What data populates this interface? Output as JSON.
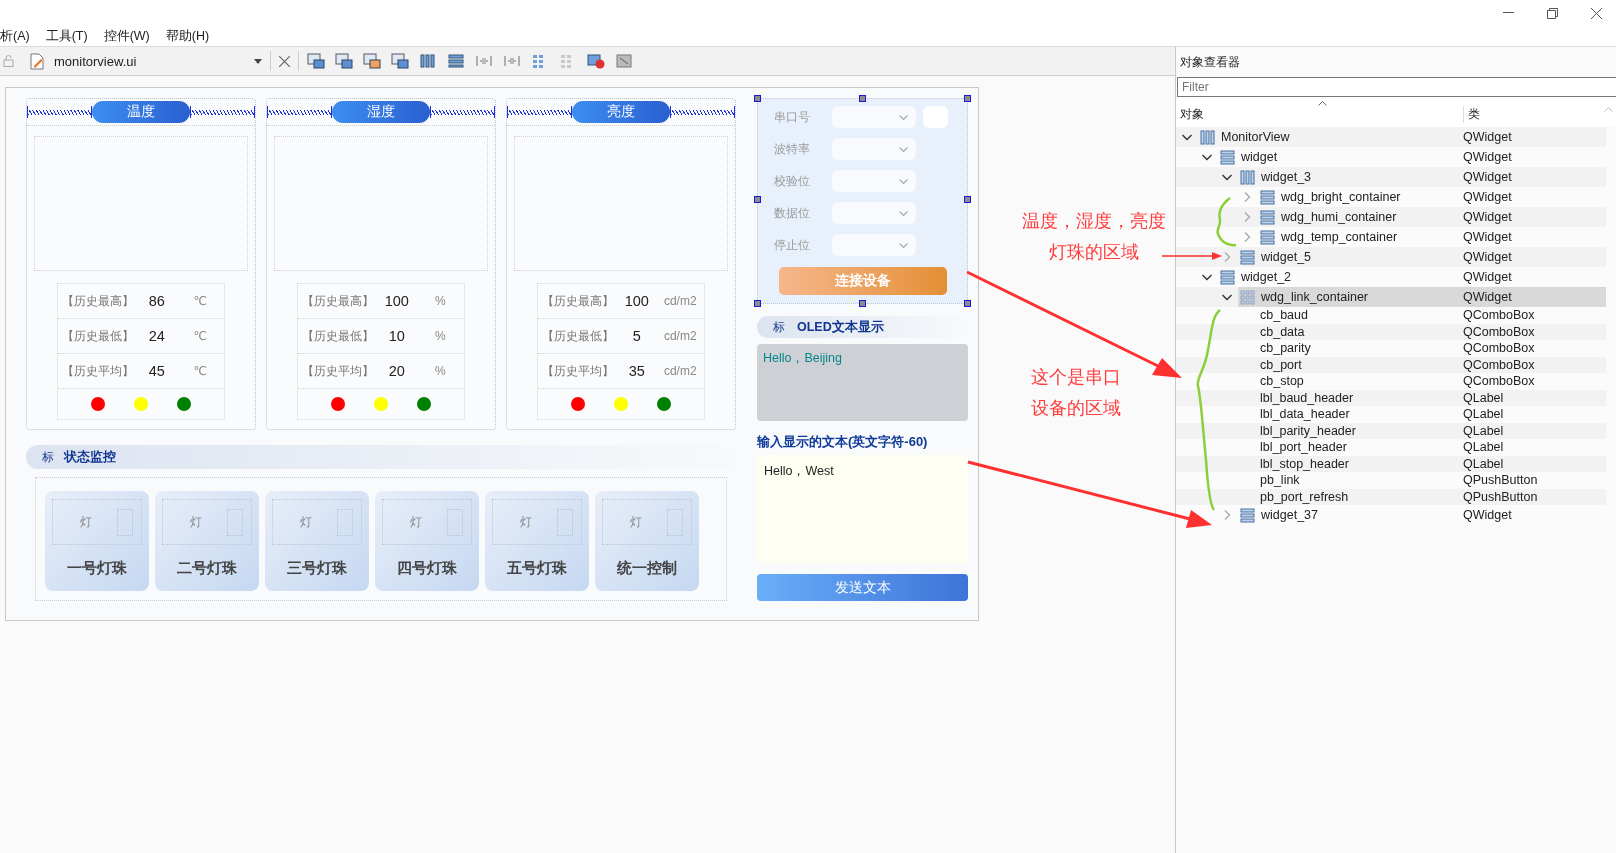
{
  "menu": [
    {
      "label": "析(A)"
    },
    {
      "label": "工具(T)"
    },
    {
      "label": "控件(W)"
    },
    {
      "label": "帮助(H)"
    }
  ],
  "toolbar": {
    "file_name": "monitorview.ui"
  },
  "form": {
    "sensor_panels": [
      {
        "title": "温度",
        "stats": [
          {
            "label": "【历史最高】",
            "value": "86",
            "unit": "℃"
          },
          {
            "label": "【历史最低】",
            "value": "24",
            "unit": "℃"
          },
          {
            "label": "【历史平均】",
            "value": "45",
            "unit": "℃"
          }
        ],
        "lights": [
          {
            "color": "#ff0000"
          },
          {
            "color": "#ffff00"
          },
          {
            "color": "#008000"
          }
        ]
      },
      {
        "title": "湿度",
        "stats": [
          {
            "label": "【历史最高】",
            "value": "100",
            "unit": "%"
          },
          {
            "label": "【历史最低】",
            "value": "10",
            "unit": "%"
          },
          {
            "label": "【历史平均】",
            "value": "20",
            "unit": "%"
          }
        ],
        "lights": [
          {
            "color": "#ff0000"
          },
          {
            "color": "#ffff00"
          },
          {
            "color": "#008000"
          }
        ]
      },
      {
        "title": "亮度",
        "stats": [
          {
            "label": "【历史最高】",
            "value": "100",
            "unit": "cd/m2"
          },
          {
            "label": "【历史最低】",
            "value": "5",
            "unit": "cd/m2"
          },
          {
            "label": "【历史平均】",
            "value": "35",
            "unit": "cd/m2"
          }
        ],
        "lights": [
          {
            "color": "#ff0000"
          },
          {
            "color": "#ffff00"
          },
          {
            "color": "#008000"
          }
        ]
      }
    ],
    "status": {
      "marker": "标",
      "title": "状态监控",
      "lamps": [
        {
          "marker": "灯",
          "label": "一号灯珠"
        },
        {
          "marker": "灯",
          "label": "二号灯珠"
        },
        {
          "marker": "灯",
          "label": "三号灯珠"
        },
        {
          "marker": "灯",
          "label": "四号灯珠"
        },
        {
          "marker": "灯",
          "label": "五号灯珠"
        },
        {
          "marker": "灯",
          "label": "统一控制"
        }
      ]
    },
    "serial": {
      "selected": true,
      "fields": [
        {
          "label": "串口号",
          "refresh_button": true
        },
        {
          "label": "波特率",
          "refresh_button": false
        },
        {
          "label": "校验位",
          "refresh_button": false
        },
        {
          "label": "数据位",
          "refresh_button": false
        },
        {
          "label": "停止位",
          "refresh_button": false
        }
      ],
      "connect_button": "连接设备"
    },
    "oled": {
      "marker": "标",
      "title": "OLED文本显示",
      "display_text": "Hello，Beijing",
      "input_label": "输入显示的文本(英文字符-60)",
      "input_value": "Hello，West",
      "send_button": "发送文本"
    }
  },
  "object_inspector": {
    "title": "对象查看器",
    "filter_placeholder": "Filter",
    "columns": [
      "对象",
      "类"
    ],
    "tree": [
      {
        "name": "MonitorView",
        "class": "QWidget",
        "kind": "horizontal",
        "expanded": true,
        "selected": false,
        "children": [
          {
            "name": "widget",
            "class": "QWidget",
            "kind": "vertical",
            "expanded": true,
            "selected": false,
            "children": [
              {
                "name": "widget_3",
                "class": "QWidget",
                "kind": "horizontal",
                "expanded": true,
                "selected": false,
                "children": [
                  {
                    "name": "wdg_bright_container",
                    "class": "QWidget",
                    "kind": "vertical",
                    "expanded": false,
                    "selected": false
                  },
                  {
                    "name": "wdg_humi_container",
                    "class": "QWidget",
                    "kind": "vertical",
                    "expanded": false,
                    "selected": false
                  },
                  {
                    "name": "wdg_temp_container",
                    "class": "QWidget",
                    "kind": "vertical",
                    "expanded": false,
                    "selected": false
                  }
                ]
              },
              {
                "name": "widget_5",
                "class": "QWidget",
                "kind": "vertical",
                "expanded": false,
                "selected": false
              }
            ]
          },
          {
            "name": "widget_2",
            "class": "QWidget",
            "kind": "vertical",
            "expanded": true,
            "selected": false,
            "children": [
              {
                "name": "wdg_link_container",
                "class": "QWidget",
                "kind": "grid",
                "expanded": true,
                "selected": true,
                "children": [
                  {
                    "name": "cb_baud",
                    "class": "QComboBox",
                    "selected": false
                  },
                  {
                    "name": "cb_data",
                    "class": "QComboBox",
                    "selected": false
                  },
                  {
                    "name": "cb_parity",
                    "class": "QComboBox",
                    "selected": false
                  },
                  {
                    "name": "cb_port",
                    "class": "QComboBox",
                    "selected": false
                  },
                  {
                    "name": "cb_stop",
                    "class": "QComboBox",
                    "selected": false
                  },
                  {
                    "name": "lbl_baud_header",
                    "class": "QLabel",
                    "selected": false
                  },
                  {
                    "name": "lbl_data_header",
                    "class": "QLabel",
                    "selected": false
                  },
                  {
                    "name": "lbl_parity_header",
                    "class": "QLabel",
                    "selected": false
                  },
                  {
                    "name": "lbl_port_header",
                    "class": "QLabel",
                    "selected": false
                  },
                  {
                    "name": "lbl_stop_header",
                    "class": "QLabel",
                    "selected": false
                  },
                  {
                    "name": "pb_link",
                    "class": "QPushButton",
                    "selected": false
                  },
                  {
                    "name": "pb_port_refresh",
                    "class": "QPushButton",
                    "selected": false
                  }
                ]
              },
              {
                "name": "widget_37",
                "class": "QWidget",
                "kind": "vertical",
                "expanded": false,
                "selected": false
              }
            ]
          }
        ]
      }
    ]
  },
  "annotations": [
    {
      "lines": [
        "温度，湿度，亮度",
        "灯珠的区域"
      ]
    },
    {
      "lines": [
        "这个是串口",
        "设备的区域"
      ]
    }
  ]
}
